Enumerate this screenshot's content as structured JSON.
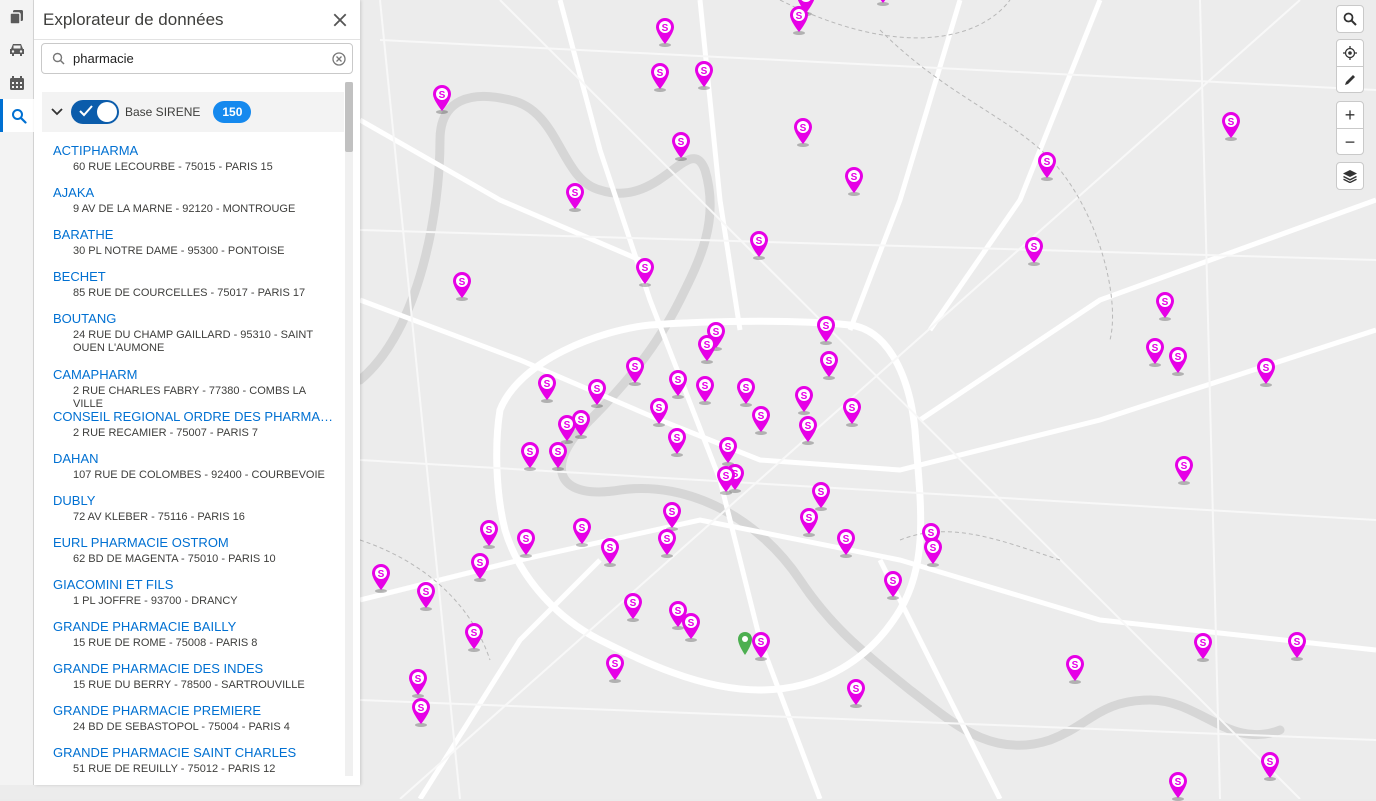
{
  "panel": {
    "title": "Explorateur de données",
    "search": {
      "value": "pharmacie",
      "placeholder": ""
    },
    "layer": {
      "name": "Base SIRENE",
      "count": "150",
      "enabled": true
    }
  },
  "results": [
    {
      "name": "ACTIPHARMA",
      "address": "60 RUE LECOURBE - 75015 - PARIS 15"
    },
    {
      "name": "AJAKA",
      "address": "9 AV DE LA MARNE - 92120 - MONTROUGE"
    },
    {
      "name": "BARATHE",
      "address": "30 PL NOTRE DAME - 95300 - PONTOISE"
    },
    {
      "name": "BECHET",
      "address": "85 RUE DE COURCELLES - 75017 - PARIS 17"
    },
    {
      "name": "BOUTANG",
      "address": "24 RUE DU CHAMP GAILLARD - 95310 - SAINT OUEN L'AUMONE"
    },
    {
      "name": "CAMAPHARM",
      "address": "2 RUE CHARLES FABRY - 77380 - COMBS LA VILLE"
    },
    {
      "name": "CONSEIL REGIONAL ORDRE DES PHARMAC...",
      "address": "2 RUE RECAMIER - 75007 - PARIS 7"
    },
    {
      "name": "DAHAN",
      "address": "107 RUE DE COLOMBES - 92400 - COURBEVOIE"
    },
    {
      "name": "DUBLY",
      "address": "72 AV KLEBER - 75116 - PARIS 16"
    },
    {
      "name": "EURL PHARMACIE OSTROM",
      "address": "62 BD DE MAGENTA - 75010 - PARIS 10"
    },
    {
      "name": "GIACOMINI ET FILS",
      "address": "1 PL JOFFRE - 93700 - DRANCY"
    },
    {
      "name": "GRANDE PHARMACIE BAILLY",
      "address": "15 RUE DE ROME - 75008 - PARIS 8"
    },
    {
      "name": "GRANDE PHARMACIE DES INDES",
      "address": "15 RUE DU BERRY - 78500 - SARTROUVILLE"
    },
    {
      "name": "GRANDE PHARMACIE PREMIERE",
      "address": "24 BD DE SEBASTOPOL - 75004 - PARIS 4"
    },
    {
      "name": "GRANDE PHARMACIE SAINT CHARLES",
      "address": "51 RUE DE REUILLY - 75012 - PARIS 12"
    }
  ],
  "map": {
    "marker_label": "S",
    "marker_color": "#e600e6",
    "selected_marker_color": "#4caf50"
  },
  "icons": {
    "rail": [
      "layers-icon",
      "car-icon",
      "calendar-icon",
      "search-icon"
    ],
    "controls": [
      "search-icon",
      "locate-icon",
      "edit-icon",
      "zoom-in-icon",
      "zoom-out-icon",
      "layers-icon"
    ]
  }
}
